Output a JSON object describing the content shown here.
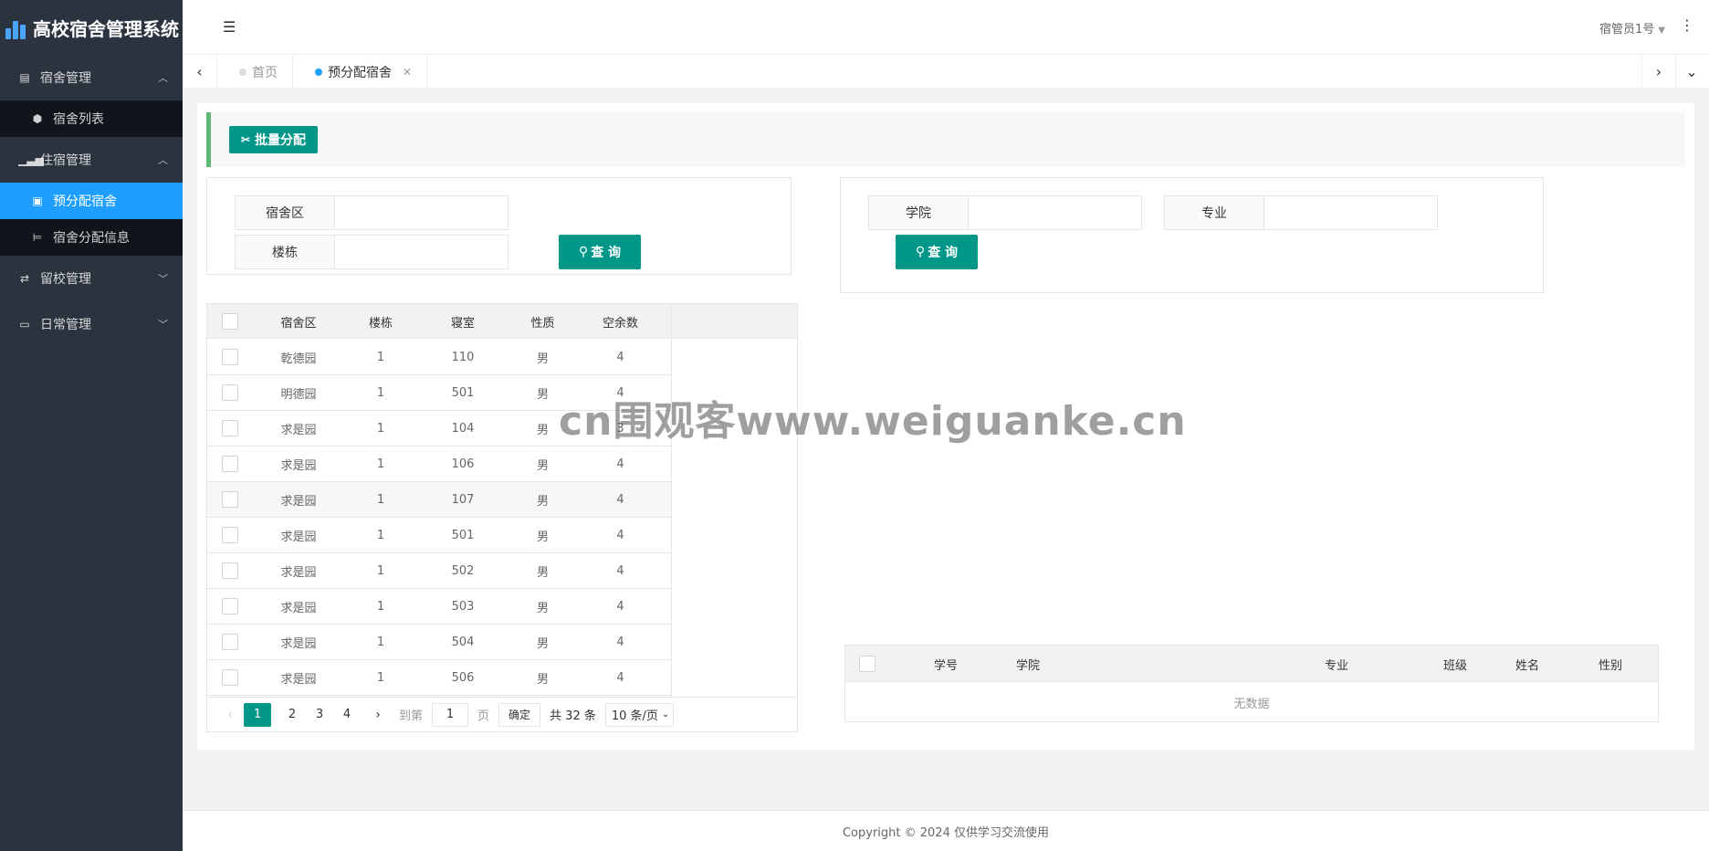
{
  "app": {
    "title": "高校宿舍管理系统"
  },
  "sidebar": {
    "groups": [
      {
        "label": "宿舍管理",
        "icon": "building-icon",
        "expanded": true,
        "items": [
          {
            "label": "宿舍列表",
            "icon": "cube-icon"
          }
        ]
      },
      {
        "label": "住宿管理",
        "icon": "chart-icon",
        "expanded": true,
        "items": [
          {
            "label": "预分配宿舍",
            "icon": "id-card-icon",
            "active": true
          },
          {
            "label": "宿舍分配信息",
            "icon": "bed-icon"
          }
        ]
      },
      {
        "label": "留校管理",
        "icon": "sync-icon",
        "expanded": false
      },
      {
        "label": "日常管理",
        "icon": "laptop-icon",
        "expanded": false
      }
    ]
  },
  "header": {
    "user": "宿管员1号"
  },
  "tabs": [
    {
      "label": "首页",
      "active": false
    },
    {
      "label": "预分配宿舍",
      "active": true
    }
  ],
  "toolbar": {
    "batch_label": "批量分配"
  },
  "left_search": {
    "area_label": "宿舍区",
    "area_value": "",
    "building_label": "楼栋",
    "building_value": "",
    "query_label": "查 询"
  },
  "right_search": {
    "college_label": "学院",
    "college_value": "",
    "major_label": "专业",
    "major_value": "",
    "query_label": "查 询"
  },
  "dorm_table": {
    "columns": [
      "宿舍区",
      "楼栋",
      "寝室",
      "性质",
      "空余数"
    ],
    "rows": [
      [
        "乾德园",
        "1",
        "110",
        "男",
        "4"
      ],
      [
        "明德园",
        "1",
        "501",
        "男",
        "4"
      ],
      [
        "求是园",
        "1",
        "104",
        "男",
        "3"
      ],
      [
        "求是园",
        "1",
        "106",
        "男",
        "4"
      ],
      [
        "求是园",
        "1",
        "107",
        "男",
        "4"
      ],
      [
        "求是园",
        "1",
        "501",
        "男",
        "4"
      ],
      [
        "求是园",
        "1",
        "502",
        "男",
        "4"
      ],
      [
        "求是园",
        "1",
        "503",
        "男",
        "4"
      ],
      [
        "求是园",
        "1",
        "504",
        "男",
        "4"
      ],
      [
        "求是园",
        "1",
        "506",
        "男",
        "4"
      ]
    ],
    "hover_row": 4
  },
  "pager": {
    "pages": [
      "1",
      "2",
      "3",
      "4"
    ],
    "current": "1",
    "goto_prefix": "到第",
    "goto_value": "1",
    "goto_suffix": "页",
    "ok_label": "确定",
    "total": "共 32 条",
    "page_size": "10 条/页"
  },
  "student_table": {
    "columns": [
      "学号",
      "学院",
      "专业",
      "班级",
      "姓名",
      "性别"
    ],
    "empty_text": "无数据"
  },
  "footer": {
    "text": "Copyright © 2024 仅供学习交流使用"
  },
  "watermark": {
    "text": "cn围观客www.weiguanke.cn"
  },
  "colors": {
    "sidebar_bg": "#2b333e",
    "active": "#1e9fff",
    "primary": "#009688",
    "accent_bar": "#5fb878"
  }
}
